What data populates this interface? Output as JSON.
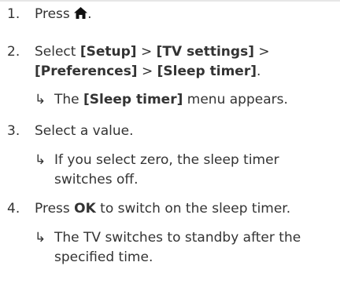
{
  "steps": [
    {
      "number": "1.",
      "text_before": "Press ",
      "icon": "home-icon",
      "text_after": "."
    },
    {
      "number": "2.",
      "select": "Select ",
      "setup": "[Setup]",
      "gt1": " > ",
      "tv_settings": "[TV settings]",
      "gt2": " >",
      "preferences": "[Preferences]",
      "gt3": " > ",
      "sleep_timer": "[Sleep timer]",
      "period": ".",
      "result_arrow": "↳",
      "result_the": "The ",
      "result_menu_name": "[Sleep timer]",
      "result_rest": " menu appears."
    },
    {
      "number": "3.",
      "text": "Select a value.",
      "result_arrow": "↳",
      "result_line1": "If you select zero, the sleep timer",
      "result_line2": "switches off."
    },
    {
      "number": "4.",
      "press": "Press ",
      "ok": "OK",
      "rest": " to switch on the sleep timer.",
      "result_arrow": "↳",
      "result_line1": "The TV switches to standby after the",
      "result_line2": "specified time."
    }
  ]
}
